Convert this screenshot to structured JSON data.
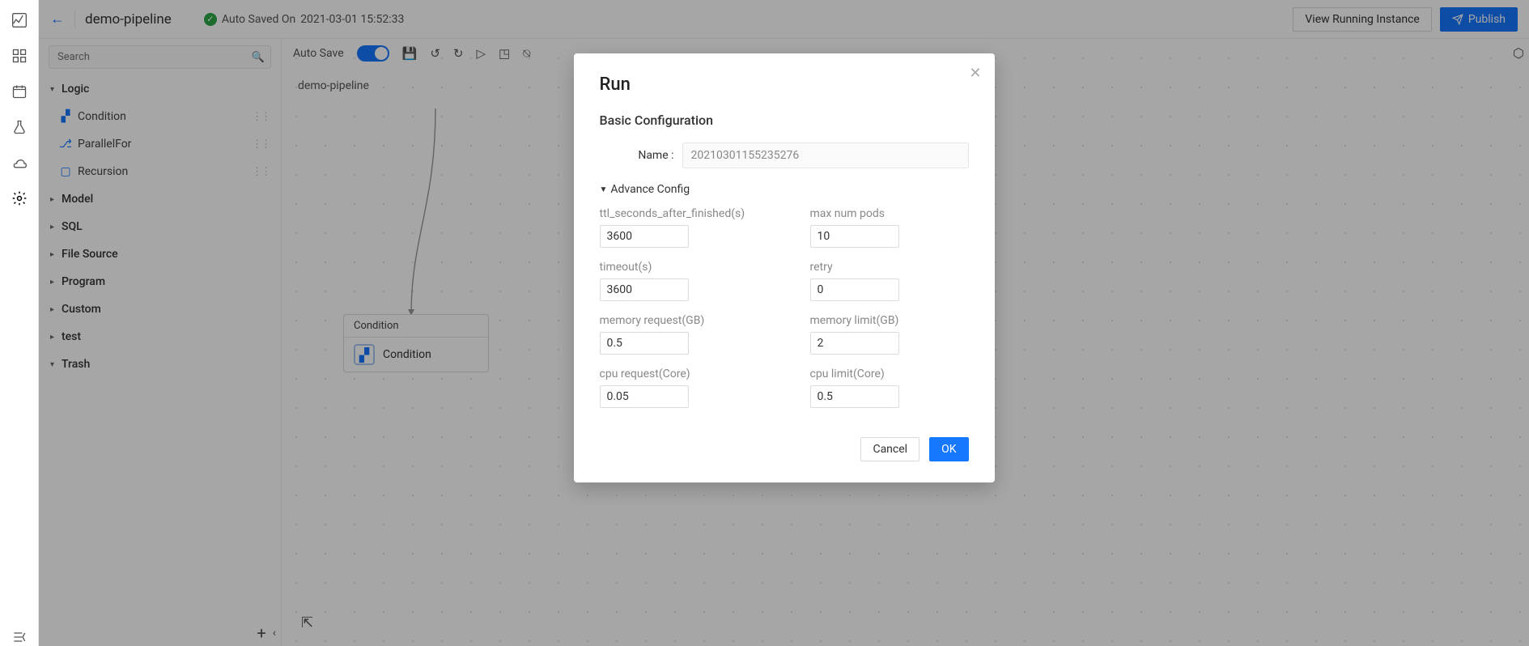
{
  "header": {
    "title": "demo-pipeline",
    "autosave_prefix": "Auto Saved On",
    "autosave_time": "2021-03-01 15:52:33",
    "view_instance": "View Running Instance",
    "publish": "Publish"
  },
  "search": {
    "placeholder": "Search"
  },
  "tree": {
    "sections": [
      "Logic",
      "Model",
      "SQL",
      "File Source",
      "Program",
      "Custom",
      "test",
      "Trash"
    ],
    "logic_items": [
      "Condition",
      "ParallelFor",
      "Recursion"
    ]
  },
  "toolbar": {
    "autosave_label": "Auto Save"
  },
  "canvas": {
    "title": "demo-pipeline",
    "node_title": "Condition",
    "node_label": "Condition"
  },
  "modal": {
    "title": "Run",
    "section": "Basic Configuration",
    "name_label": "Name :",
    "name_value": "20210301155235276",
    "advance_label": "Advance Config",
    "fields": {
      "ttl_label": "ttl_seconds_after_finished(s)",
      "ttl_value": "3600",
      "maxpods_label": "max num pods",
      "maxpods_value": "10",
      "timeout_label": "timeout(s)",
      "timeout_value": "3600",
      "retry_label": "retry",
      "retry_value": "0",
      "memreq_label": "memory request(GB)",
      "memreq_value": "0.5",
      "memlim_label": "memory limit(GB)",
      "memlim_value": "2",
      "cpureq_label": "cpu request(Core)",
      "cpureq_value": "0.05",
      "cpulim_label": "cpu limit(Core)",
      "cpulim_value": "0.5"
    },
    "cancel": "Cancel",
    "ok": "OK"
  }
}
